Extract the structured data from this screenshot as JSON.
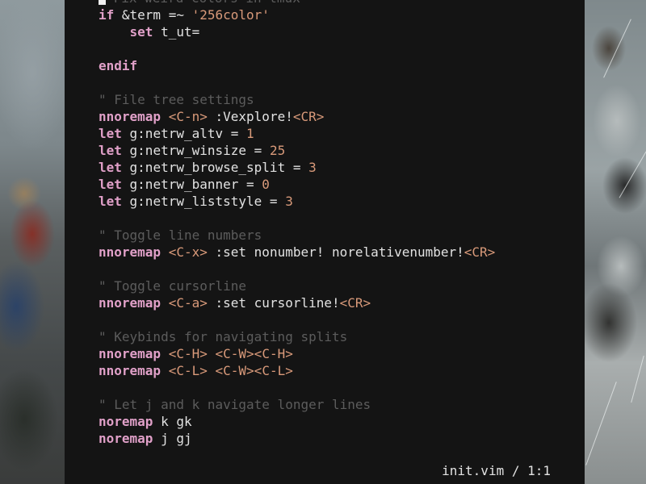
{
  "editor": {
    "lines": [
      [
        {
          "t": "cursor"
        },
        {
          "t": "cmt",
          "v": " Fix weird colors in tmux"
        }
      ],
      [
        {
          "t": "kw",
          "v": "if"
        },
        {
          "t": "txt",
          "v": " &term =~ "
        },
        {
          "t": "str",
          "v": "'256color'"
        }
      ],
      [
        {
          "t": "txt",
          "v": "    "
        },
        {
          "t": "kw",
          "v": "set"
        },
        {
          "t": "txt",
          "v": " t_ut="
        }
      ],
      [],
      [
        {
          "t": "kw",
          "v": "endif"
        }
      ],
      [],
      [
        {
          "t": "cmt",
          "v": "\" File tree settings"
        }
      ],
      [
        {
          "t": "kw",
          "v": "nnoremap"
        },
        {
          "t": "txt",
          "v": " "
        },
        {
          "t": "key",
          "v": "<C-n>"
        },
        {
          "t": "txt",
          "v": " :Vexplore!"
        },
        {
          "t": "key",
          "v": "<CR>"
        }
      ],
      [
        {
          "t": "kw",
          "v": "let"
        },
        {
          "t": "txt",
          "v": " g:netrw_altv = "
        },
        {
          "t": "num",
          "v": "1"
        }
      ],
      [
        {
          "t": "kw",
          "v": "let"
        },
        {
          "t": "txt",
          "v": " g:netrw_winsize = "
        },
        {
          "t": "num",
          "v": "25"
        }
      ],
      [
        {
          "t": "kw",
          "v": "let"
        },
        {
          "t": "txt",
          "v": " g:netrw_browse_split = "
        },
        {
          "t": "num",
          "v": "3"
        }
      ],
      [
        {
          "t": "kw",
          "v": "let"
        },
        {
          "t": "txt",
          "v": " g:netrw_banner = "
        },
        {
          "t": "num",
          "v": "0"
        }
      ],
      [
        {
          "t": "kw",
          "v": "let"
        },
        {
          "t": "txt",
          "v": " g:netrw_liststyle = "
        },
        {
          "t": "num",
          "v": "3"
        }
      ],
      [],
      [
        {
          "t": "cmt",
          "v": "\" Toggle line numbers"
        }
      ],
      [
        {
          "t": "kw",
          "v": "nnoremap"
        },
        {
          "t": "txt",
          "v": " "
        },
        {
          "t": "key",
          "v": "<C-x>"
        },
        {
          "t": "txt",
          "v": " :set nonumber! norelativenumber!"
        },
        {
          "t": "key",
          "v": "<CR>"
        }
      ],
      [],
      [
        {
          "t": "cmt",
          "v": "\" Toggle cursorline"
        }
      ],
      [
        {
          "t": "kw",
          "v": "nnoremap"
        },
        {
          "t": "txt",
          "v": " "
        },
        {
          "t": "key",
          "v": "<C-a>"
        },
        {
          "t": "txt",
          "v": " :set cursorline!"
        },
        {
          "t": "key",
          "v": "<CR>"
        }
      ],
      [],
      [
        {
          "t": "cmt",
          "v": "\" Keybinds for navigating splits"
        }
      ],
      [
        {
          "t": "kw",
          "v": "nnoremap"
        },
        {
          "t": "txt",
          "v": " "
        },
        {
          "t": "key",
          "v": "<C-H>"
        },
        {
          "t": "txt",
          "v": " "
        },
        {
          "t": "key",
          "v": "<C-W><C-H>"
        }
      ],
      [
        {
          "t": "kw",
          "v": "nnoremap"
        },
        {
          "t": "txt",
          "v": " "
        },
        {
          "t": "key",
          "v": "<C-L>"
        },
        {
          "t": "txt",
          "v": " "
        },
        {
          "t": "key",
          "v": "<C-W><C-L>"
        }
      ],
      [],
      [
        {
          "t": "cmt",
          "v": "\" Let j and k navigate longer lines"
        }
      ],
      [
        {
          "t": "kw",
          "v": "noremap"
        },
        {
          "t": "txt",
          "v": " k gk"
        }
      ],
      [
        {
          "t": "kw",
          "v": "noremap"
        },
        {
          "t": "txt",
          "v": " j gj"
        }
      ]
    ]
  },
  "statusline": {
    "text": "init.vim / 1:1"
  },
  "colors": {
    "background": "#141414",
    "keyword": "#e0a0c8",
    "comment": "#5c5c5c",
    "string": "#d99a7a",
    "text": "#e2e2e2"
  }
}
